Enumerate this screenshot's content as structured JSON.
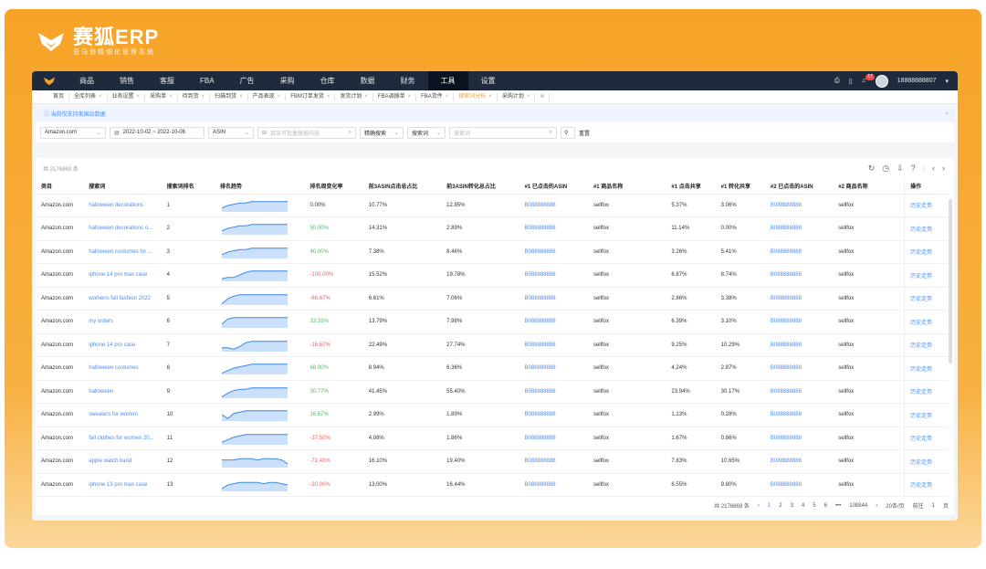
{
  "brand": {
    "name": "赛狐ERP",
    "sub": "亚马逊精细化管理系统"
  },
  "nav": {
    "items": [
      "商品",
      "销售",
      "客服",
      "FBA",
      "广告",
      "采购",
      "仓库",
      "数据",
      "财务",
      "工具",
      "设置"
    ],
    "active_index": 9,
    "user": "18888888807",
    "notif_count": "17"
  },
  "tabs": [
    {
      "label": "首页",
      "active": false
    },
    {
      "label": "全库列表",
      "active": false
    },
    {
      "label": "业务设置",
      "active": false
    },
    {
      "label": "采购单",
      "active": false
    },
    {
      "label": "待到货",
      "active": false
    },
    {
      "label": "扫描到货",
      "active": false
    },
    {
      "label": "产品表现",
      "active": false
    },
    {
      "label": "FBM订单发货",
      "active": false
    },
    {
      "label": "发货计划",
      "active": false
    },
    {
      "label": "FBA调拨单",
      "active": false
    },
    {
      "label": "FBA货件",
      "active": false
    },
    {
      "label": "搜索词分析",
      "active": true
    },
    {
      "label": "采购计划",
      "active": false
    }
  ],
  "notice": "当前仅支持美国站数据",
  "filters": {
    "marketplace": "Amazon.com",
    "date_range": "2022-10-02 ~ 2022-10-08",
    "asin_type": "ASIN",
    "asin_placeholder": "双击可批量搜索内容",
    "match": "精确搜索",
    "field": "搜索词",
    "search_placeholder": "搜索词",
    "reset": "重置"
  },
  "total": "共 2176869 条",
  "columns": [
    "类目",
    "搜索词",
    "搜索词排名",
    "排名趋势",
    "排名周变化率",
    "前3ASIN点击总占比",
    "前3ASIN转化总占比",
    "#1 已点击的ASIN",
    "#1 商品名称",
    "#1 点击共享",
    "#1 转化共享",
    "#2 已点击的ASIN",
    "#2 商品名称",
    "操作"
  ],
  "rows": [
    {
      "cat": "Amazon.com",
      "kw": "halloween decorations",
      "rank": "1",
      "chg": "0.00%",
      "chg_type": "n",
      "c3": "10.77%",
      "v3": "12.85%",
      "asin1": "B088888888",
      "name1": "sellfox",
      "cs1": "5.37%",
      "vs1": "3.06%",
      "asin2": "B088888888",
      "name2": "sellfox",
      "op": "历史走势",
      "trend": [
        14,
        12,
        11,
        10,
        10,
        9,
        9,
        9,
        9,
        9,
        9,
        9
      ]
    },
    {
      "cat": "Amazon.com",
      "kw": "halloween decorations o...",
      "rank": "2",
      "chg": "50.00%",
      "chg_type": "g",
      "c3": "14.31%",
      "v3": "2.89%",
      "asin1": "B088888888",
      "name1": "sellfox",
      "cs1": "11.14%",
      "vs1": "0.00%",
      "asin2": "B088888888",
      "name2": "sellfox",
      "op": "历史走势",
      "trend": [
        14,
        12,
        11,
        10,
        10,
        9,
        9,
        9,
        9,
        9,
        9,
        9
      ]
    },
    {
      "cat": "Amazon.com",
      "kw": "halloween costumes for ...",
      "rank": "3",
      "chg": "40.00%",
      "chg_type": "g",
      "c3": "7.38%",
      "v3": "8.46%",
      "asin1": "B088888888",
      "name1": "sellfox",
      "cs1": "3.26%",
      "vs1": "5.41%",
      "asin2": "B088888888",
      "name2": "sellfox",
      "op": "历史走势",
      "trend": [
        14,
        12,
        11,
        10,
        10,
        9,
        9,
        9,
        9,
        9,
        9,
        9
      ]
    },
    {
      "cat": "Amazon.com",
      "kw": "iphone 14 pro max case",
      "rank": "4",
      "chg": "-100.00%",
      "chg_type": "r",
      "c3": "15.52%",
      "v3": "19.78%",
      "asin1": "B088888888",
      "name1": "sellfox",
      "cs1": "6.87%",
      "vs1": "8.74%",
      "asin2": "B088888888",
      "name2": "sellfox",
      "op": "历史走势",
      "trend": [
        15,
        14,
        14,
        12,
        10,
        9,
        9,
        9,
        9,
        9,
        9,
        9
      ]
    },
    {
      "cat": "Amazon.com",
      "kw": "womens fall fashion 2022",
      "rank": "5",
      "chg": "-66.67%",
      "chg_type": "r",
      "c3": "6.61%",
      "v3": "7.06%",
      "asin1": "B088888888",
      "name1": "sellfox",
      "cs1": "2.86%",
      "vs1": "3.38%",
      "asin2": "B088888888",
      "name2": "sellfox",
      "op": "历史走势",
      "trend": [
        16,
        12,
        10,
        9,
        9,
        9,
        9,
        9,
        9,
        9,
        9,
        9
      ]
    },
    {
      "cat": "Amazon.com",
      "kw": "my orders",
      "rank": "6",
      "chg": "33.33%",
      "chg_type": "g",
      "c3": "13.79%",
      "v3": "7.98%",
      "asin1": "B088888888",
      "name1": "sellfox",
      "cs1": "6.39%",
      "vs1": "3.10%",
      "asin2": "B088888888",
      "name2": "sellfox",
      "op": "历史走势",
      "trend": [
        14,
        10,
        9,
        9,
        9,
        9,
        9,
        9,
        9,
        9,
        9,
        9
      ]
    },
    {
      "cat": "Amazon.com",
      "kw": "iphone 14 pro case",
      "rank": "7",
      "chg": "-16.67%",
      "chg_type": "r",
      "c3": "22.49%",
      "v3": "27.74%",
      "asin1": "B088888888",
      "name1": "sellfox",
      "cs1": "9.25%",
      "vs1": "10.29%",
      "asin2": "B088888888",
      "name2": "sellfox",
      "op": "历史走势",
      "trend": [
        14,
        14,
        15,
        13,
        10,
        9,
        9,
        9,
        9,
        9,
        9,
        9
      ]
    },
    {
      "cat": "Amazon.com",
      "kw": "halloween costumes",
      "rank": "8",
      "chg": "68.00%",
      "chg_type": "g",
      "c3": "8.94%",
      "v3": "6.36%",
      "asin1": "B088888888",
      "name1": "sellfox",
      "cs1": "4.24%",
      "vs1": "2.87%",
      "asin2": "B088888888",
      "name2": "sellfox",
      "op": "历史走势",
      "trend": [
        16,
        14,
        12,
        11,
        10,
        9,
        9,
        9,
        9,
        9,
        9,
        9
      ]
    },
    {
      "cat": "Amazon.com",
      "kw": "halloween",
      "rank": "9",
      "chg": "30.77%",
      "chg_type": "g",
      "c3": "41.45%",
      "v3": "55.40%",
      "asin1": "B088888888",
      "name1": "sellfox",
      "cs1": "23.94%",
      "vs1": "30.17%",
      "asin2": "B088888888",
      "name2": "sellfox",
      "op": "历史走势",
      "trend": [
        16,
        13,
        11,
        10,
        10,
        9,
        9,
        9,
        9,
        9,
        9,
        9
      ]
    },
    {
      "cat": "Amazon.com",
      "kw": "sweaters for women",
      "rank": "10",
      "chg": "16.67%",
      "chg_type": "g",
      "c3": "2.99%",
      "v3": "1.89%",
      "asin1": "B088888888",
      "name1": "sellfox",
      "cs1": "1.13%",
      "vs1": "0.28%",
      "asin2": "B088888888",
      "name2": "sellfox",
      "op": "历史走势",
      "trend": [
        12,
        15,
        11,
        10,
        9,
        9,
        9,
        9,
        9,
        9,
        9,
        9
      ]
    },
    {
      "cat": "Amazon.com",
      "kw": "fall clothes for women 20...",
      "rank": "11",
      "chg": "-37.50%",
      "chg_type": "r",
      "c3": "4.08%",
      "v3": "1.86%",
      "asin1": "B088888888",
      "name1": "sellfox",
      "cs1": "1.67%",
      "vs1": "0.86%",
      "asin2": "B088888888",
      "name2": "sellfox",
      "op": "历史走势",
      "trend": [
        15,
        13,
        11,
        10,
        9,
        9,
        9,
        9,
        9,
        9,
        9,
        9
      ]
    },
    {
      "cat": "Amazon.com",
      "kw": "apple watch band",
      "rank": "12",
      "chg": "-71.43%",
      "chg_type": "r",
      "c3": "16.10%",
      "v3": "19.40%",
      "asin1": "B088888888",
      "name1": "sellfox",
      "cs1": "7.83%",
      "vs1": "10.65%",
      "asin2": "B088888888",
      "name2": "sellfox",
      "op": "历史走势",
      "trend": [
        11,
        11,
        11,
        10,
        10,
        10,
        11,
        10,
        10,
        10,
        11,
        14
      ]
    },
    {
      "cat": "Amazon.com",
      "kw": "iphone 13 pro max case",
      "rank": "13",
      "chg": "-30.00%",
      "chg_type": "r",
      "c3": "13.00%",
      "v3": "16.44%",
      "asin1": "B088888888",
      "name1": "sellfox",
      "cs1": "6.55%",
      "vs1": "9.80%",
      "asin2": "B088888888",
      "name2": "sellfox",
      "op": "历史走势",
      "trend": [
        15,
        12,
        11,
        10,
        10,
        10,
        10,
        11,
        10,
        10,
        11,
        12
      ]
    }
  ],
  "pager": {
    "total": "共 2176869 条",
    "pages": [
      "1",
      "2",
      "3",
      "4",
      "5",
      "6"
    ],
    "ellipsis": "•••",
    "last": "108844",
    "size": "20条/页",
    "goto": "前往",
    "goto_page": "1",
    "page_unit": "页"
  },
  "colors": {
    "accent": "#f7a328",
    "link": "#4c8cf5",
    "green": "#52b96a",
    "red": "#f06060",
    "nav": "#1f2a3c"
  }
}
